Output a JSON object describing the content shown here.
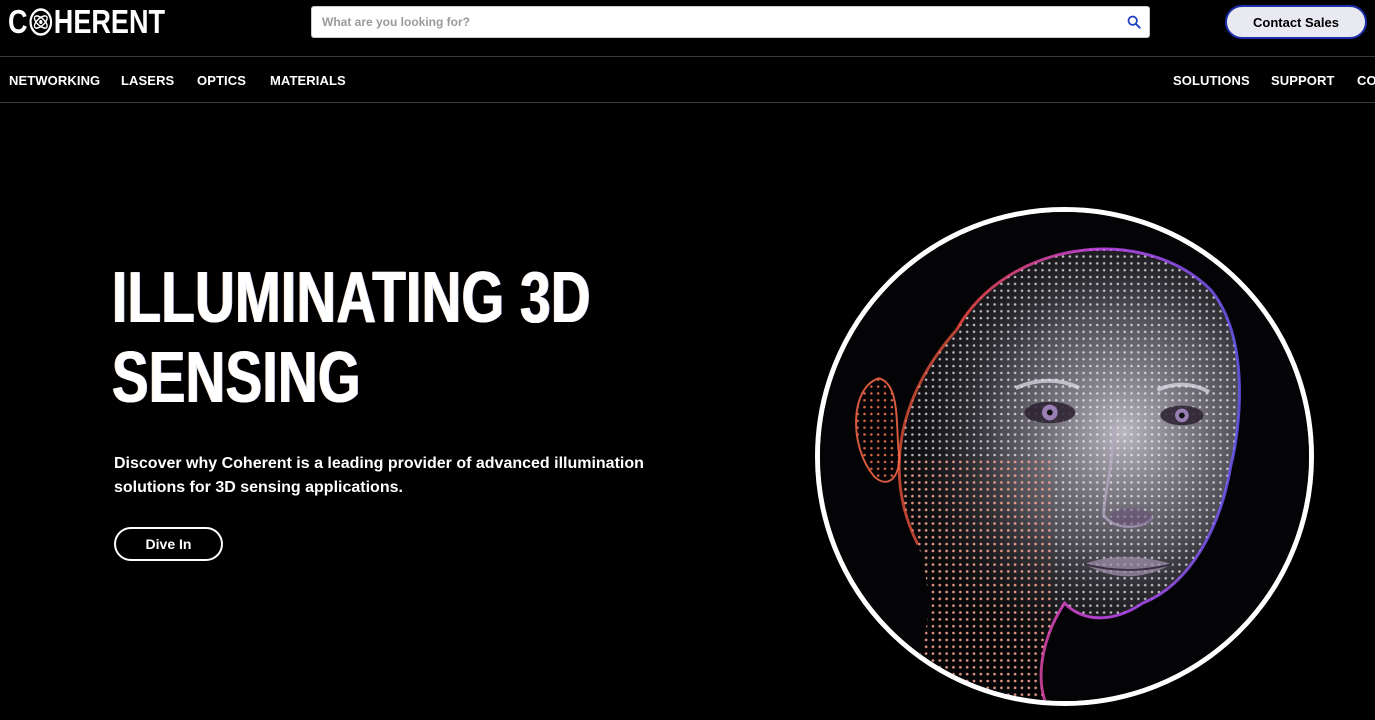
{
  "header": {
    "logo_prefix": "C",
    "logo_suffix": "HERENT",
    "search_placeholder": "What are you looking for?",
    "contact_label": "Contact Sales"
  },
  "nav": {
    "left_items": [
      "NETWORKING",
      "LASERS",
      "OPTICS",
      "MATERIALS"
    ],
    "right_items": [
      "SOLUTIONS",
      "SUPPORT",
      "CO"
    ]
  },
  "hero": {
    "title_line1": "ILLUMINATING 3D",
    "title_line2": "SENSING",
    "description": "Discover why Coherent is a leading provider of advanced illumination solutions for 3D sensing applications.",
    "cta_label": "Dive In"
  },
  "icons": {
    "logo_mark": "atom-orbit-icon",
    "search": "search-icon"
  },
  "colors": {
    "background": "#000000",
    "accent_blue": "#1d2fa8",
    "contact_bg": "#e9e9f2"
  }
}
